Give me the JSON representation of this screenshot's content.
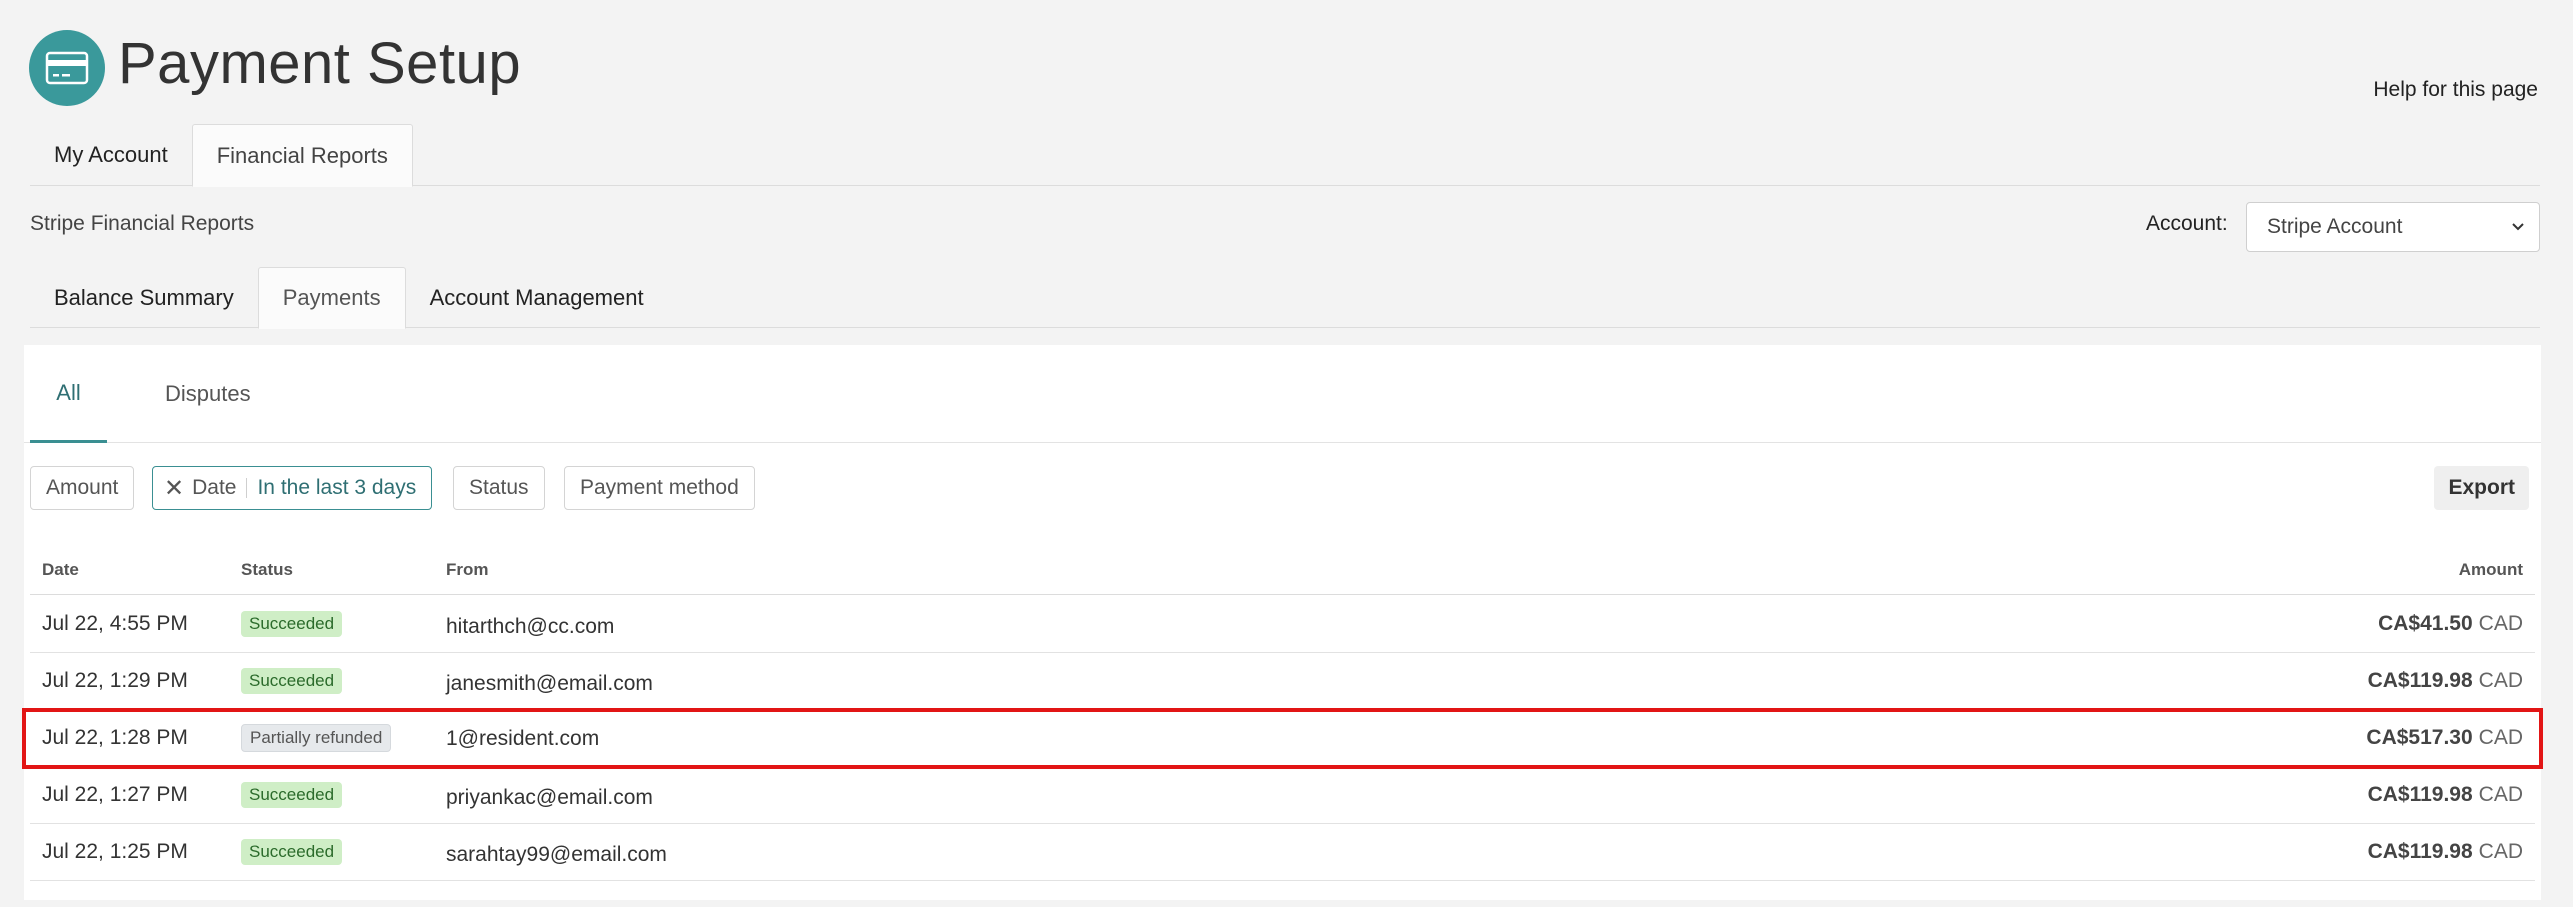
{
  "header": {
    "title": "Payment Setup",
    "help_link": "Help for this page",
    "logo_icon": "credit-card-icon"
  },
  "top_tabs": [
    {
      "label": "My Account",
      "active": false
    },
    {
      "label": "Financial Reports",
      "active": true
    }
  ],
  "section": {
    "label": "Stripe Financial Reports",
    "account_label": "Account:",
    "account_value": "Stripe Account"
  },
  "sub_tabs": [
    {
      "label": "Balance Summary",
      "active": false
    },
    {
      "label": "Payments",
      "active": true
    },
    {
      "label": "Account Management",
      "active": false
    }
  ],
  "filter_tabs": {
    "all": "All",
    "disputes": "Disputes"
  },
  "filters": {
    "amount": "Amount",
    "date_label": "Date",
    "date_value": "In the last 3 days",
    "status": "Status",
    "payment_method": "Payment method",
    "export": "Export"
  },
  "table": {
    "headers": {
      "date": "Date",
      "status": "Status",
      "from": "From",
      "amount": "Amount"
    },
    "rows": [
      {
        "date": "Jul 22, 4:55 PM",
        "status": "Succeeded",
        "from": "hitarthch@cc.com",
        "amount": "CA$41.50",
        "currency": "CAD"
      },
      {
        "date": "Jul 22, 1:29 PM",
        "status": "Succeeded",
        "from": "janesmith@email.com",
        "amount": "CA$119.98",
        "currency": "CAD"
      },
      {
        "date": "Jul 22, 1:28 PM",
        "status": "Partially refunded",
        "from": "1@resident.com",
        "amount": "CA$517.30",
        "currency": "CAD"
      },
      {
        "date": "Jul 22, 1:27 PM",
        "status": "Succeeded",
        "from": "priyankac@email.com",
        "amount": "CA$119.98",
        "currency": "CAD"
      },
      {
        "date": "Jul 22, 1:25 PM",
        "status": "Succeeded",
        "from": "sarahtay99@email.com",
        "amount": "CA$119.98",
        "currency": "CAD"
      }
    ]
  },
  "colors": {
    "accent": "#3a999b",
    "highlight": "#e21515",
    "success_bg": "#cfeec6"
  }
}
